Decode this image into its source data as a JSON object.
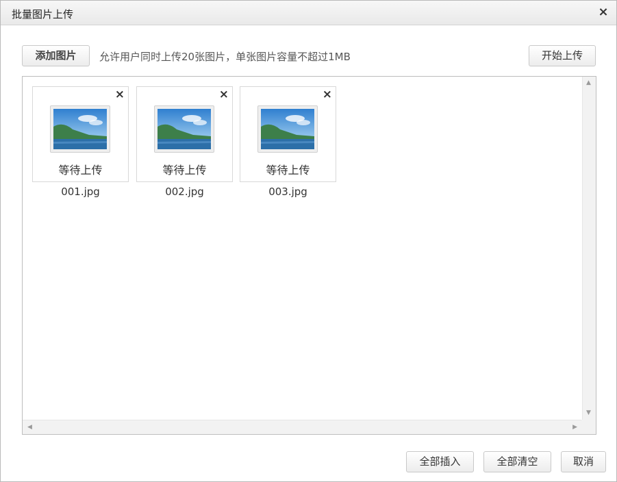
{
  "dialog": {
    "title": "批量图片上传",
    "close_label": "×"
  },
  "toolbar": {
    "add_label": "添加图片",
    "hint": "允许用户同时上传20张图片，单张图片容量不超过1MB",
    "start_label": "开始上传"
  },
  "files": [
    {
      "name": "001.jpg",
      "status": "等待上传",
      "remove": "×"
    },
    {
      "name": "002.jpg",
      "status": "等待上传",
      "remove": "×"
    },
    {
      "name": "003.jpg",
      "status": "等待上传",
      "remove": "×"
    }
  ],
  "footer": {
    "insert_all_label": "全部插入",
    "clear_all_label": "全部清空",
    "cancel_label": "取消"
  },
  "icons": {
    "thumbnail": "landscape-image-icon",
    "remove": "close-icon"
  }
}
